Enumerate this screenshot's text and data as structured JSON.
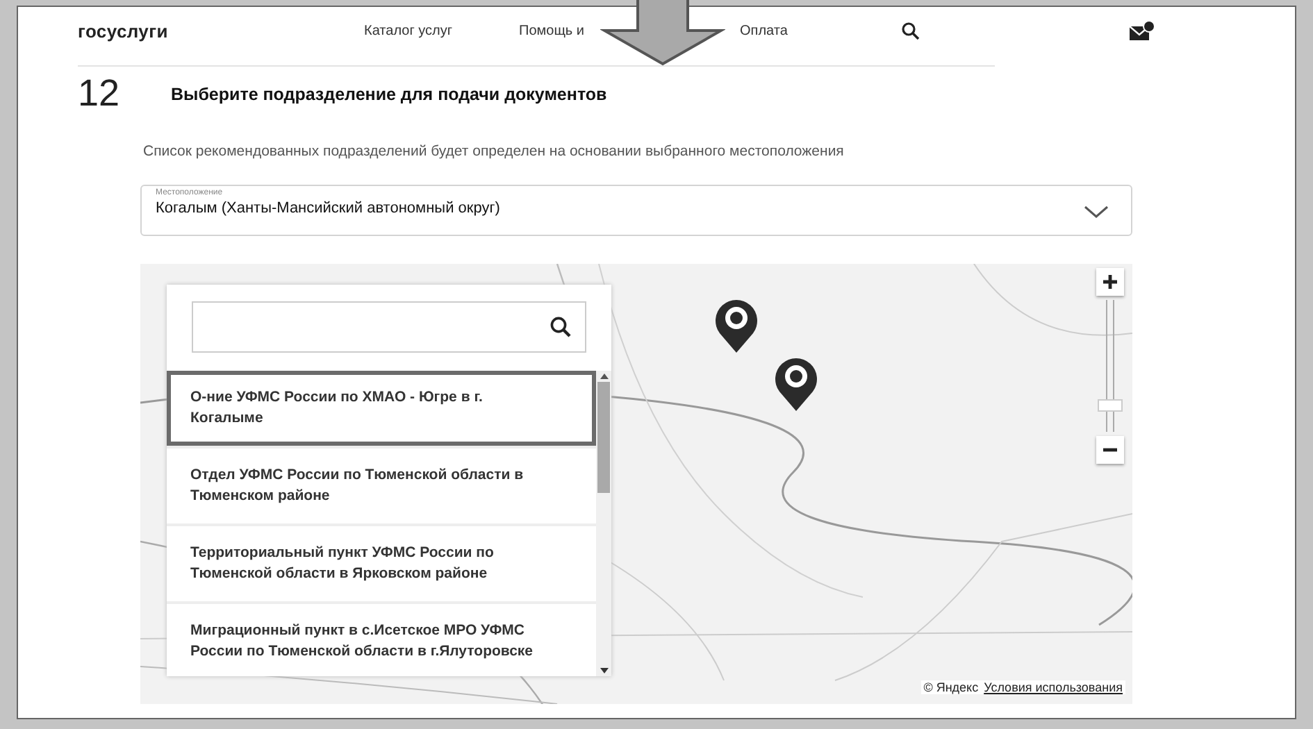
{
  "header": {
    "logo": "госуслуги",
    "nav": [
      {
        "label": "Каталог услуг"
      },
      {
        "label": "Помощь и"
      },
      {
        "label": "Оплата"
      }
    ],
    "mail_unread": true
  },
  "step": {
    "number": "12",
    "title": "Выберите подразделение для подачи документов"
  },
  "hint": "Список рекомендованных подразделений будет определен на основании выбранного местоположения",
  "location": {
    "label": "Местоположение",
    "value": "Когалым (Ханты-Мансийский автономный округ)"
  },
  "map": {
    "zoom": {
      "level": 0.2
    },
    "offices": [
      {
        "name": "О-ние УФМС России по ХМАО - Югре в г. Когалыме",
        "selected": true
      },
      {
        "name": "Отдел УФМС России по Тюменской области в Тюменском районе",
        "selected": false
      },
      {
        "name": "Территориальный пункт УФМС России по Тюменской области в Ярковском районе",
        "selected": false
      },
      {
        "name": "Миграционный пункт в с.Исетское МРО УФМС России по Тюменской области в г.Ялуторовске",
        "selected": false
      }
    ],
    "attribution": "© Яндекс",
    "terms_link": "Условия использования"
  }
}
